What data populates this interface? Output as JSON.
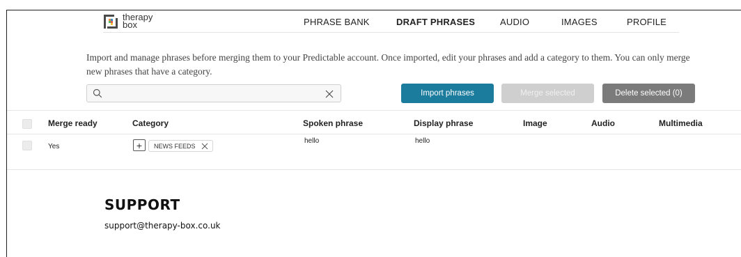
{
  "brand": {
    "line1": "therapy",
    "line2": "box"
  },
  "nav": {
    "items": [
      {
        "label": "PHRASE BANK"
      },
      {
        "label": "DRAFT PHRASES"
      },
      {
        "label": "AUDIO"
      },
      {
        "label": "IMAGES"
      },
      {
        "label": "PROFILE"
      }
    ],
    "active": "DRAFT PHRASES"
  },
  "intro": {
    "text": "Import and manage phrases before merging them to your Predictable account. Once imported, edit your phrases and add a category to them. You can only merge new phrases that have a category."
  },
  "search": {
    "value": "",
    "placeholder": ""
  },
  "actions": {
    "import_label": "Import phrases",
    "merge_label": "Merge selected",
    "delete_label": "Delete selected (0)"
  },
  "table": {
    "columns": [
      "Merge ready",
      "Category",
      "Spoken phrase",
      "Display phrase",
      "Image",
      "Audio",
      "Multimedia"
    ],
    "rows": [
      {
        "merge_ready": "Yes",
        "category": "NEWS FEEDS",
        "spoken": "hello",
        "display": "hello"
      }
    ]
  },
  "support": {
    "title": "SUPPORT",
    "email": "support@therapy-box.co.uk"
  },
  "colors": {
    "primary": "#1b7c9e",
    "disabled": "#cfcfcf",
    "delete": "#7b7b7b",
    "logo_orange": "#f08a3c",
    "logo_blue": "#3a8fc7",
    "logo_green": "#5cb85c",
    "logo_red": "#e2574c"
  },
  "icons": {
    "search": "search-icon",
    "clear": "close-icon",
    "add_category": "plus-icon",
    "remove_chip": "close-icon"
  }
}
